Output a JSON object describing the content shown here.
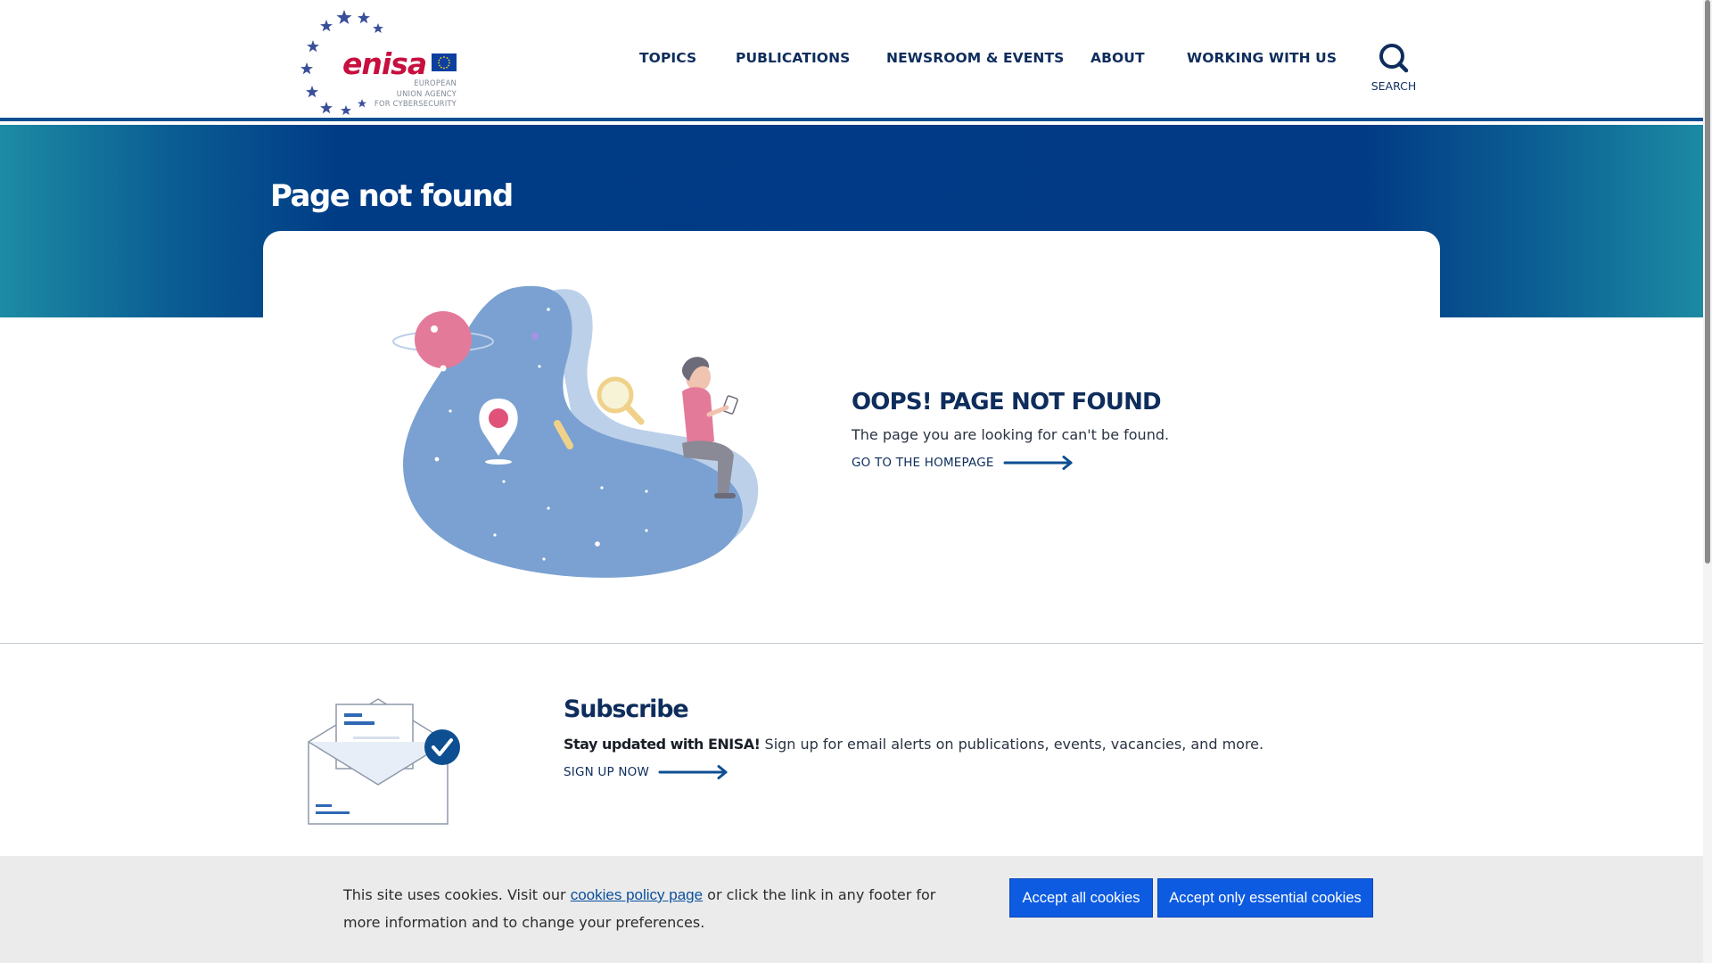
{
  "logo": {
    "wordmark": "enisa",
    "subtitle_line1": "EUROPEAN",
    "subtitle_line2": "UNION AGENCY",
    "subtitle_line3": "FOR CYBERSECURITY"
  },
  "nav": {
    "items": [
      "TOPICS",
      "PUBLICATIONS",
      "NEWSROOM & EVENTS",
      "ABOUT",
      "WORKING WITH US"
    ],
    "search_label": "SEARCH",
    "search_icon": "search-icon"
  },
  "hero": {
    "title": "Page not found"
  },
  "error": {
    "heading": "OOPS! PAGE NOT FOUND",
    "message": "The page you are looking for can't be found.",
    "link_label": "GO TO THE HOMEPAGE",
    "illustration": "space-location-illustration"
  },
  "subscribe": {
    "title": "Subscribe",
    "lead": "Stay updated with ENISA!",
    "text": " Sign up for email alerts on publications, events, vacancies, and more.",
    "link_label": "SIGN UP NOW",
    "illustration": "newsletter-envelope-icon"
  },
  "cookies": {
    "text_before": "This site uses cookies. Visit our ",
    "link_label": "cookies policy page",
    "text_after": " or click the link in any footer for more information and to change your preferences.",
    "accept_all_label": "Accept all cookies",
    "accept_essential_label": "Accept only essential cookies"
  },
  "colors": {
    "brand_navy": "#0e2d5c",
    "brand_red": "#c7103f",
    "hero_blue": "#023a85",
    "hero_teal": "#1d8ba4",
    "button_blue": "#0d5be1",
    "cookie_bg": "#ebebeb"
  }
}
